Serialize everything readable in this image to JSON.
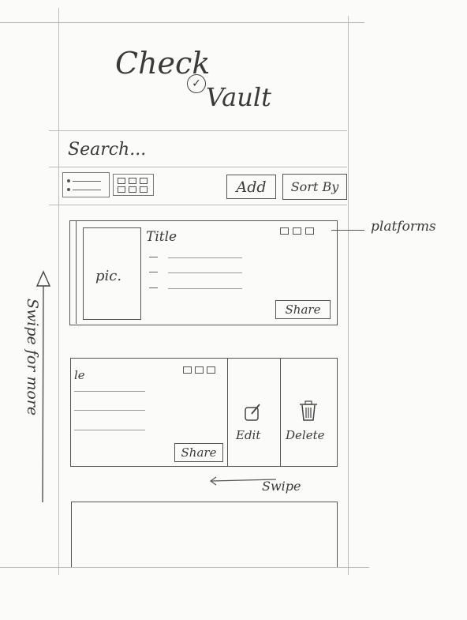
{
  "app": {
    "title_line1": "Check",
    "title_line2": "Vault"
  },
  "search": {
    "placeholder": "Search..."
  },
  "toolbar": {
    "add_label": "Add",
    "sort_label": "Sort By"
  },
  "card1": {
    "pic_label": "pic.",
    "title": "Title",
    "share_label": "Share",
    "platforms_annotation": "platforms"
  },
  "card2": {
    "title": "le",
    "share_label": "Share",
    "edit_label": "Edit",
    "delete_label": "Delete"
  },
  "annotations": {
    "swipe_for_more": "Swipe for more",
    "swipe": "Swipe"
  },
  "icons": {
    "checkmark": "✓",
    "edit": "pencil-square-icon",
    "delete": "trash-icon"
  }
}
